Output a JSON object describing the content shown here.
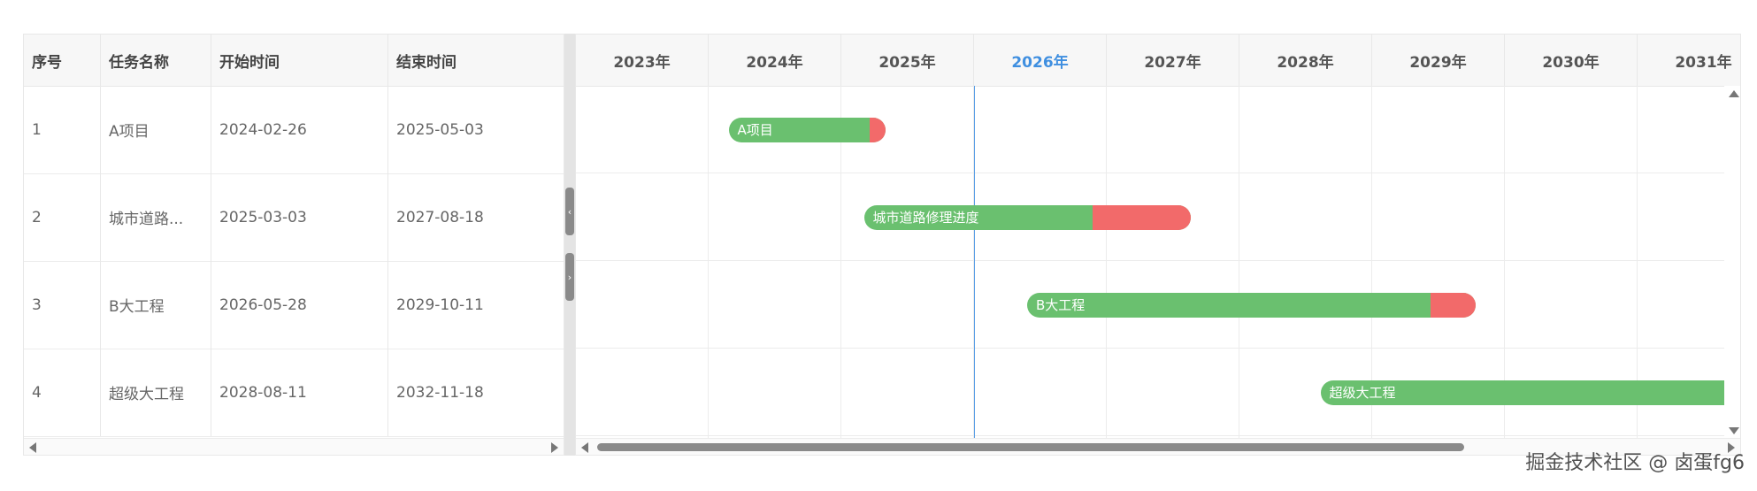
{
  "table": {
    "columns": [
      "序号",
      "任务名称",
      "开始时间",
      "结束时间"
    ],
    "rows": [
      {
        "index": "1",
        "name": "A项目",
        "start": "2024-02-26",
        "end": "2025-05-03"
      },
      {
        "index": "2",
        "name": "城市道路...",
        "start": "2025-03-03",
        "end": "2027-08-18"
      },
      {
        "index": "3",
        "name": "B大工程",
        "start": "2026-05-28",
        "end": "2029-10-11"
      },
      {
        "index": "4",
        "name": "超级大工程",
        "start": "2028-08-11",
        "end": "2032-11-18"
      }
    ]
  },
  "splitter": {
    "collapse_glyph": "‹",
    "expand_glyph": "›"
  },
  "timeline": {
    "years": [
      "2023年",
      "2024年",
      "2025年",
      "2026年",
      "2027年",
      "2028年",
      "2029年",
      "2030年",
      "2031年"
    ],
    "current_year": "2026年",
    "today_fraction_of_year": 0.0,
    "today_year_index": 3
  },
  "bars": [
    {
      "label": "A项目",
      "start_year": 2024.15,
      "end_year": 2025.33,
      "progress_fraction": 0.9,
      "row": 0
    },
    {
      "label": "城市道路修理进度",
      "start_year": 2025.17,
      "end_year": 2027.63,
      "progress_fraction": 0.7,
      "row": 1
    },
    {
      "label": "B大工程",
      "start_year": 2026.4,
      "end_year": 2029.78,
      "progress_fraction": 0.9,
      "row": 2
    },
    {
      "label": "超级大工程",
      "start_year": 2028.61,
      "end_year": 2032.88,
      "progress_fraction": 1.0,
      "row": 3
    }
  ],
  "colors": {
    "progress": "#6ac06f",
    "remaining": "#f26a6a",
    "today_line": "#5b9fe6",
    "current_year": "#3f8fe0"
  },
  "watermark": "掘金技术社区 @ 卤蛋fg6"
}
